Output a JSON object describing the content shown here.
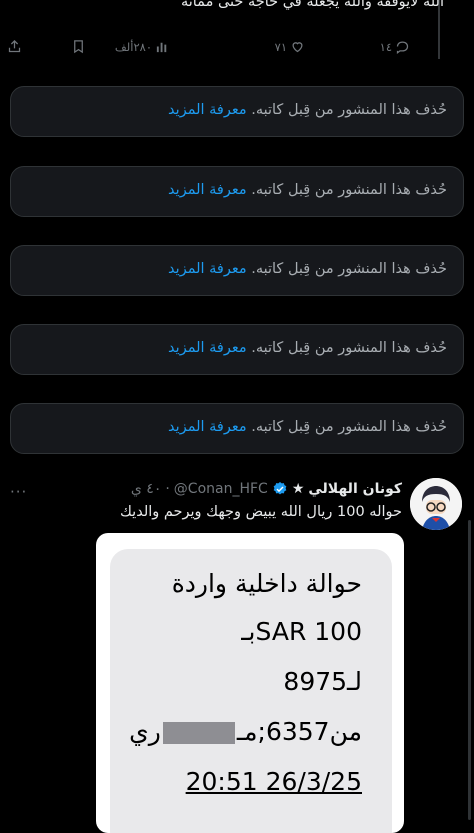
{
  "top_tweet": {
    "text": "الله لايوفقه والله يجعله في حاجه حتى مماته",
    "stats": {
      "replies": "١٤",
      "likes": "٧١",
      "views": "٢٨٠ألف"
    }
  },
  "removed_notice": {
    "text": "حُذف هذا المنشور من قِبل كاتبه.",
    "link": "معرفة المزيد"
  },
  "tweet": {
    "display_name": "كونان الهلالي",
    "star": "★",
    "handle": "@Conan_HFC",
    "separator": "·",
    "time": "٤٠ ي",
    "text": "حواله 100 ريال الله يبيض وجهك ويرحم والديك",
    "more": "···"
  },
  "sms": {
    "line1": "حوالة داخلية واردة",
    "line2": "بـSAR 100",
    "line3": "لـ8975",
    "line4_prefix": "من6357;مـ",
    "line4_suffix": "ري",
    "line5": "20:51 26/3/25"
  },
  "colors": {
    "accent": "#1d9bf0",
    "muted": "#71767b",
    "card_bg": "#16181c"
  }
}
